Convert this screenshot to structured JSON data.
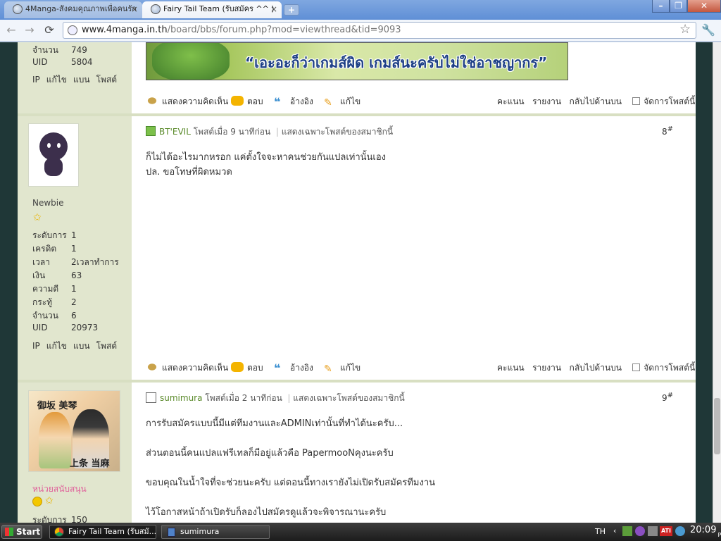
{
  "browser": {
    "tabs": [
      {
        "label": "4Manga-สังคมคุณภาพเพื่อคนรัก",
        "active": false
      },
      {
        "label": "Fairy Tail Team (รับสมัคร ^^ )",
        "active": true
      }
    ],
    "url_host": "www.4manga.in.th",
    "url_path": "/board/bbs/forum.php?mod=viewthread&tid=9093"
  },
  "post7_sidebar": {
    "stats": [
      {
        "label": "จำนวน",
        "value": "749"
      },
      {
        "label": "UID",
        "value": "5804"
      }
    ],
    "links": [
      "IP",
      "แก้ไข",
      "แบน",
      "โพสต์"
    ],
    "banner_text": "“เอะอะก็ว่าเกมส์ผิด เกมส์นะครับไม่ใช่อาชญากร”"
  },
  "actions": {
    "comment": "แสดงความคิดเห็น",
    "reply": "ตอบ",
    "quote": "อ้างอิง",
    "edit": "แก้ไข",
    "rate": "คะแนน",
    "report": "รายงาน",
    "back_to_top": "กลับไปด้านบน",
    "manage": "จัดการโพสต์นี้"
  },
  "post8": {
    "username": "BT'EVIL",
    "posted": "โพสต์เมื่อ 9 นาทีก่อน",
    "only_author": "แสดงเฉพาะโพสต์ของสมาชิกนี้",
    "number": "8",
    "group": "Newbie",
    "stats": [
      {
        "label": "ระดับการ",
        "value": "1"
      },
      {
        "label": "เครดิต",
        "value": "1"
      },
      {
        "label": "เวลา",
        "value": "2เวลาทำการ"
      },
      {
        "label": "เงิน",
        "value": "63"
      },
      {
        "label": "ความดี",
        "value": "1"
      },
      {
        "label": "กระทู้",
        "value": "2"
      },
      {
        "label": "จำนวน",
        "value": "6"
      },
      {
        "label": "UID",
        "value": "20973"
      }
    ],
    "links": [
      "IP",
      "แก้ไข",
      "แบน",
      "โพสต์"
    ],
    "body": [
      "ก็ไม่ได้อะไรมากหรอก แค่ตั้งใจจะหาคนช่วยกันแปลเท่านั้นเอง",
      "ปล. ขอโทษที่ผิดหมวด"
    ]
  },
  "post9": {
    "username": "sumimura",
    "posted": "โพสต์เมื่อ 2 นาทีก่อน",
    "only_author": "แสดงเฉพาะโพสต์ของสมาชิกนี้",
    "number": "9",
    "group": "หน่วยสนับสนุน",
    "avatar_text_top": "御坂 美琴",
    "avatar_text_bottom": "上条 当麻",
    "stats": [
      {
        "label": "ระดับการ",
        "value": "150"
      }
    ],
    "body": [
      "การรับสมัครแบบนี้มีแต่ทีมงานและADMINเท่านั้นที่ทำได้นะครับ...",
      "ส่วนตอนนี้คนแปลแฟรีเทลก็มีอยู่แล้วคือ PapermooNคุงนะครับ",
      "ขอบคุณในน้ำใจที่จะช่วยนะครับ แต่ตอนนี้ทางเรายังไม่เปิดรับสมัครทีมงาน",
      "ไว้โอกาสหน้าถ้าเปิดรับก็ลองไปสมัครดูแล้วจะพิจารณานะครับ"
    ]
  },
  "taskbar": {
    "start": "Start",
    "items": [
      {
        "label": "Fairy Tail Team (รับสมั...",
        "active": true
      },
      {
        "label": "sumimura",
        "active": false
      }
    ],
    "lang": "TH",
    "time": "20:09",
    "ampm": "PM"
  }
}
